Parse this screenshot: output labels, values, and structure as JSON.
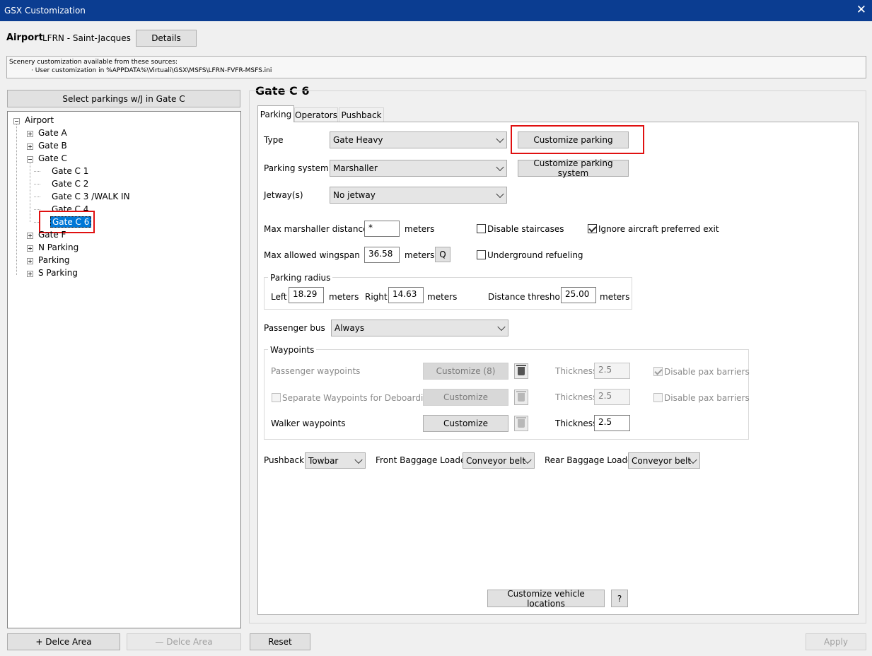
{
  "window": {
    "title": "GSX Customization"
  },
  "airport": {
    "label": "Airport",
    "name": "LFRN - Saint-Jacques",
    "details_label": "Details"
  },
  "sources": {
    "line1": "Scenery customization available from these sources:",
    "line2": "· User customization in %APPDATA%\\Virtuali\\GSX\\MSFS\\LFRN-FVFR-MSFS.ini"
  },
  "left": {
    "select_label": "Select parkings w/J in Gate C",
    "tree": {
      "root": "Airport",
      "gate_a": "Gate A",
      "gate_b": "Gate B",
      "gate_c": "Gate C",
      "gate_c1": "Gate C 1",
      "gate_c2": "Gate C 2",
      "gate_c3": "Gate C 3 /WALK IN",
      "gate_c4": "Gate C 4",
      "gate_c6": "Gate C 6",
      "gate_f": "Gate F",
      "n_parking": "N Parking",
      "parking": "Parking",
      "s_parking": "S Parking"
    },
    "add_area": "+ Delce Area",
    "remove_area": "— Delce Area"
  },
  "panel": {
    "title": "Gate C 6",
    "tabs": {
      "parking": "Parking",
      "operators": "Operators",
      "pushback": "Pushback"
    },
    "type_label": "Type",
    "type_value": "Gate Heavy",
    "customize_parking": "Customize parking",
    "parking_system_label": "Parking system",
    "parking_system_value": "Marshaller",
    "customize_parking_system": "Customize parking system",
    "jetway_label": "Jetway(s)",
    "jetway_value": "No jetway",
    "max_marshaller_label": "Max marshaller distance",
    "max_marshaller_value": "*",
    "meters": "meters",
    "disable_staircases": "Disable staircases",
    "ignore_exit": "Ignore aircraft preferred exit",
    "max_wingspan_label": "Max allowed wingspan",
    "max_wingspan_value": "36.58",
    "q_label": "Q",
    "underground_refueling": "Underground refueling",
    "radius": {
      "title": "Parking radius",
      "left_label": "Left",
      "left_value": "18.29",
      "right_label": "Right",
      "right_value": "14.63",
      "threshold_label": "Distance threshold",
      "threshold_value": "25.00"
    },
    "bus_label": "Passenger bus",
    "bus_value": "Always",
    "waypoints": {
      "title": "Waypoints",
      "passenger_label": "Passenger waypoints",
      "passenger_btn": "Customize (8)",
      "separate_label": "Separate Waypoints for Deboarding",
      "separate_btn": "Customize",
      "walker_label": "Walker waypoints",
      "walker_btn": "Customize",
      "thickness_label": "Thickness",
      "thickness1": "2.5",
      "thickness2": "2.5",
      "thickness3": "2.5",
      "disable_pax_barriers": "Disable pax barriers"
    },
    "pushback_label": "Pushback",
    "pushback_value": "Towbar",
    "front_loader_label": "Front Baggage Loader",
    "front_loader_value": "Conveyor belt",
    "rear_loader_label": "Rear Baggage Loader",
    "rear_loader_value": "Conveyor belt",
    "vehicle_locations": "Customize vehicle locations",
    "help": "?"
  },
  "footer": {
    "reset": "Reset",
    "apply": "Apply"
  }
}
